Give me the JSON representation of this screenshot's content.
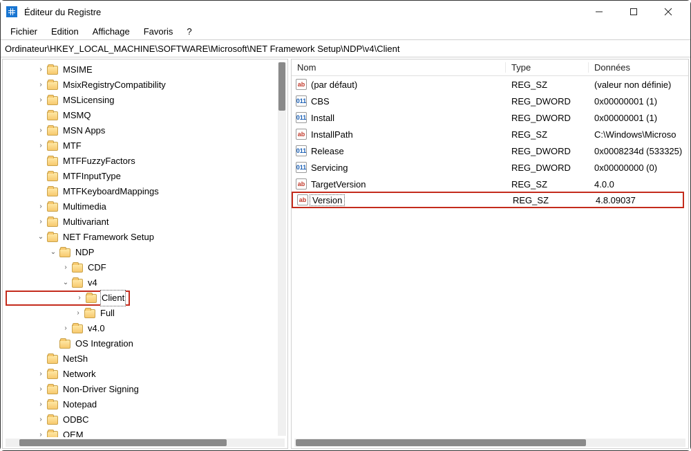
{
  "window": {
    "title": "Éditeur du Registre"
  },
  "menu": {
    "file": "Fichier",
    "edit": "Edition",
    "view": "Affichage",
    "favorites": "Favoris",
    "help": "?"
  },
  "address": "Ordinateur\\HKEY_LOCAL_MACHINE\\SOFTWARE\\Microsoft\\NET Framework Setup\\NDP\\v4\\Client",
  "tree": [
    {
      "label": "MSIME",
      "indent": 2,
      "expander": "collapsed"
    },
    {
      "label": "MsixRegistryCompatibility",
      "indent": 2,
      "expander": "collapsed"
    },
    {
      "label": "MSLicensing",
      "indent": 2,
      "expander": "collapsed"
    },
    {
      "label": "MSMQ",
      "indent": 2,
      "expander": "none"
    },
    {
      "label": "MSN Apps",
      "indent": 2,
      "expander": "collapsed"
    },
    {
      "label": "MTF",
      "indent": 2,
      "expander": "collapsed"
    },
    {
      "label": "MTFFuzzyFactors",
      "indent": 2,
      "expander": "none"
    },
    {
      "label": "MTFInputType",
      "indent": 2,
      "expander": "none"
    },
    {
      "label": "MTFKeyboardMappings",
      "indent": 2,
      "expander": "none"
    },
    {
      "label": "Multimedia",
      "indent": 2,
      "expander": "collapsed"
    },
    {
      "label": "Multivariant",
      "indent": 2,
      "expander": "collapsed"
    },
    {
      "label": "NET Framework Setup",
      "indent": 2,
      "expander": "expanded"
    },
    {
      "label": "NDP",
      "indent": 3,
      "expander": "expanded"
    },
    {
      "label": "CDF",
      "indent": 4,
      "expander": "collapsed"
    },
    {
      "label": "v4",
      "indent": 4,
      "expander": "expanded"
    },
    {
      "label": "Client",
      "indent": 5,
      "expander": "collapsed",
      "selected": true,
      "highlight": true
    },
    {
      "label": "Full",
      "indent": 5,
      "expander": "collapsed"
    },
    {
      "label": "v4.0",
      "indent": 4,
      "expander": "collapsed"
    },
    {
      "label": "OS Integration",
      "indent": 3,
      "expander": "none"
    },
    {
      "label": "NetSh",
      "indent": 2,
      "expander": "none"
    },
    {
      "label": "Network",
      "indent": 2,
      "expander": "collapsed"
    },
    {
      "label": "Non-Driver Signing",
      "indent": 2,
      "expander": "collapsed"
    },
    {
      "label": "Notepad",
      "indent": 2,
      "expander": "collapsed"
    },
    {
      "label": "ODBC",
      "indent": 2,
      "expander": "collapsed"
    },
    {
      "label": "OEM",
      "indent": 2,
      "expander": "collapsed"
    }
  ],
  "list": {
    "headers": {
      "name": "Nom",
      "type": "Type",
      "data": "Données"
    },
    "rows": [
      {
        "icon": "sz",
        "name": "(par défaut)",
        "type": "REG_SZ",
        "data": "(valeur non définie)"
      },
      {
        "icon": "dw",
        "name": "CBS",
        "type": "REG_DWORD",
        "data": "0x00000001 (1)"
      },
      {
        "icon": "dw",
        "name": "Install",
        "type": "REG_DWORD",
        "data": "0x00000001 (1)"
      },
      {
        "icon": "sz",
        "name": "InstallPath",
        "type": "REG_SZ",
        "data": "C:\\Windows\\Microso"
      },
      {
        "icon": "dw",
        "name": "Release",
        "type": "REG_DWORD",
        "data": "0x0008234d (533325)"
      },
      {
        "icon": "dw",
        "name": "Servicing",
        "type": "REG_DWORD",
        "data": "0x00000000 (0)"
      },
      {
        "icon": "sz",
        "name": "TargetVersion",
        "type": "REG_SZ",
        "data": "4.0.0"
      },
      {
        "icon": "sz",
        "name": "Version",
        "type": "REG_SZ",
        "data": "4.8.09037",
        "highlight": true,
        "selected": true
      }
    ]
  },
  "icon_text": {
    "sz": "ab",
    "dw": "011"
  }
}
